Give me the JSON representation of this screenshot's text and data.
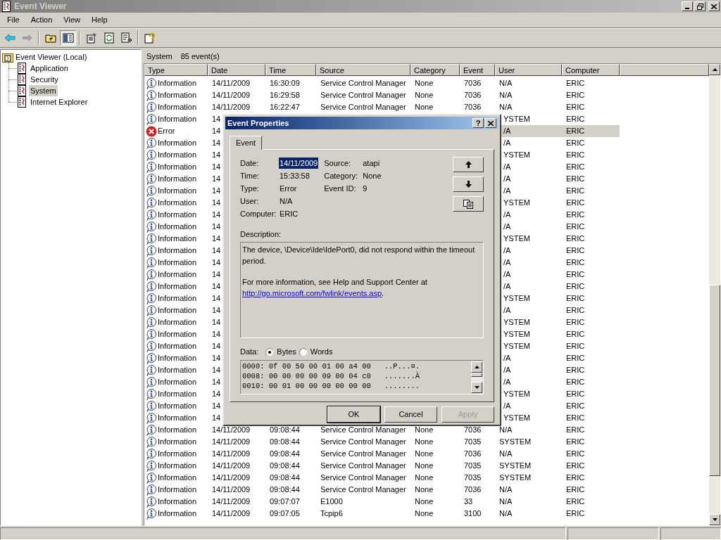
{
  "window": {
    "title": "Event Viewer"
  },
  "menu": [
    "File",
    "Action",
    "View",
    "Help"
  ],
  "toolbar": [
    {
      "kind": "back",
      "pressed": false,
      "disabled": false
    },
    {
      "kind": "forward",
      "pressed": false,
      "disabled": true
    },
    {
      "kind": "separator"
    },
    {
      "kind": "up-folder",
      "pressed": false,
      "disabled": false
    },
    {
      "kind": "tree-toggle",
      "pressed": true,
      "disabled": false
    },
    {
      "kind": "separator"
    },
    {
      "kind": "properties",
      "pressed": false,
      "disabled": false
    },
    {
      "kind": "refresh",
      "pressed": false,
      "disabled": false
    },
    {
      "kind": "export",
      "pressed": false,
      "disabled": false
    },
    {
      "kind": "separator"
    },
    {
      "kind": "help",
      "pressed": false,
      "disabled": false
    }
  ],
  "tree": {
    "label": "Event Viewer (Local)",
    "children": [
      {
        "label": "Application",
        "selected": false
      },
      {
        "label": "Security",
        "selected": false
      },
      {
        "label": "System",
        "selected": true
      },
      {
        "label": "Internet Explorer",
        "selected": false
      }
    ]
  },
  "list_header": {
    "log": "System",
    "count": "85 event(s)"
  },
  "table": {
    "columns": [
      "Type",
      "Date",
      "Time",
      "Source",
      "Category",
      "Event",
      "User",
      "Computer"
    ],
    "rows": [
      {
        "kind": "information",
        "type": "Information",
        "date": "14/11/2009",
        "time": "16:30:09",
        "source": "Service Control Manager",
        "category": "None",
        "event": "7036",
        "user": "N/A",
        "computer": "ERIC",
        "selected": false
      },
      {
        "kind": "information",
        "type": "Information",
        "date": "14/11/2009",
        "time": "16:29:58",
        "source": "Service Control Manager",
        "category": "None",
        "event": "7036",
        "user": "N/A",
        "computer": "ERIC",
        "selected": false
      },
      {
        "kind": "information",
        "type": "Information",
        "date": "14/11/2009",
        "time": "16:22:47",
        "source": "Service Control Manager",
        "category": "None",
        "event": "7036",
        "user": "N/A",
        "computer": "ERIC",
        "selected": false
      },
      {
        "kind": "information",
        "type": "Information",
        "date": "14",
        "user": "YSTEM",
        "computer": "ERIC",
        "selected": false
      },
      {
        "kind": "error",
        "type": "Error",
        "date": "14",
        "user": "/A",
        "computer": "ERIC",
        "selected": true
      },
      {
        "kind": "information",
        "type": "Information",
        "date": "14",
        "user": "/A",
        "computer": "ERIC",
        "selected": false
      },
      {
        "kind": "information",
        "type": "Information",
        "date": "14",
        "user": "YSTEM",
        "computer": "ERIC",
        "selected": false
      },
      {
        "kind": "information",
        "type": "Information",
        "date": "14",
        "user": "/A",
        "computer": "ERIC",
        "selected": false
      },
      {
        "kind": "information",
        "type": "Information",
        "date": "14",
        "user": "/A",
        "computer": "ERIC",
        "selected": false
      },
      {
        "kind": "information",
        "type": "Information",
        "date": "14",
        "user": "/A",
        "computer": "ERIC",
        "selected": false
      },
      {
        "kind": "information",
        "type": "Information",
        "date": "14",
        "user": "YSTEM",
        "computer": "ERIC",
        "selected": false
      },
      {
        "kind": "information",
        "type": "Information",
        "date": "14",
        "user": "/A",
        "computer": "ERIC",
        "selected": false
      },
      {
        "kind": "information",
        "type": "Information",
        "date": "14",
        "user": "/A",
        "computer": "ERIC",
        "selected": false
      },
      {
        "kind": "information",
        "type": "Information",
        "date": "14",
        "user": "YSTEM",
        "computer": "ERIC",
        "selected": false
      },
      {
        "kind": "information",
        "type": "Information",
        "date": "14",
        "user": "/A",
        "computer": "ERIC",
        "selected": false
      },
      {
        "kind": "information",
        "type": "Information",
        "date": "14",
        "user": "/A",
        "computer": "ERIC",
        "selected": false
      },
      {
        "kind": "information",
        "type": "Information",
        "date": "14",
        "user": "/A",
        "computer": "ERIC",
        "selected": false
      },
      {
        "kind": "information",
        "type": "Information",
        "date": "14",
        "user": "/A",
        "computer": "ERIC",
        "selected": false
      },
      {
        "kind": "information",
        "type": "Information",
        "date": "14",
        "user": "YSTEM",
        "computer": "ERIC",
        "selected": false
      },
      {
        "kind": "information",
        "type": "Information",
        "date": "14",
        "user": "/A",
        "computer": "ERIC",
        "selected": false
      },
      {
        "kind": "information",
        "type": "Information",
        "date": "14",
        "user": "YSTEM",
        "computer": "ERIC",
        "selected": false
      },
      {
        "kind": "information",
        "type": "Information",
        "date": "14",
        "user": "YSTEM",
        "computer": "ERIC",
        "selected": false
      },
      {
        "kind": "information",
        "type": "Information",
        "date": "14",
        "user": "YSTEM",
        "computer": "ERIC",
        "selected": false
      },
      {
        "kind": "information",
        "type": "Information",
        "date": "14",
        "user": "/A",
        "computer": "ERIC",
        "selected": false
      },
      {
        "kind": "information",
        "type": "Information",
        "date": "14",
        "user": "/A",
        "computer": "ERIC",
        "selected": false
      },
      {
        "kind": "information",
        "type": "Information",
        "date": "14",
        "user": "/A",
        "computer": "ERIC",
        "selected": false
      },
      {
        "kind": "information",
        "type": "Information",
        "date": "14",
        "user": "YSTEM",
        "computer": "ERIC",
        "selected": false
      },
      {
        "kind": "information",
        "type": "Information",
        "date": "14",
        "user": "/A",
        "computer": "ERIC",
        "selected": false
      },
      {
        "kind": "information",
        "type": "Information",
        "date": "14",
        "user": "YSTEM",
        "computer": "ERIC",
        "selected": false
      },
      {
        "kind": "information",
        "type": "Information",
        "date": "14/11/2009",
        "time": "09:08:44",
        "source": "Service Control Manager",
        "category": "None",
        "event": "7036",
        "user": "N/A",
        "computer": "ERIC",
        "selected": false
      },
      {
        "kind": "information",
        "type": "Information",
        "date": "14/11/2009",
        "time": "09:08:44",
        "source": "Service Control Manager",
        "category": "None",
        "event": "7035",
        "user": "SYSTEM",
        "computer": "ERIC",
        "selected": false
      },
      {
        "kind": "information",
        "type": "Information",
        "date": "14/11/2009",
        "time": "09:08:44",
        "source": "Service Control Manager",
        "category": "None",
        "event": "7036",
        "user": "N/A",
        "computer": "ERIC",
        "selected": false
      },
      {
        "kind": "information",
        "type": "Information",
        "date": "14/11/2009",
        "time": "09:08:44",
        "source": "Service Control Manager",
        "category": "None",
        "event": "7035",
        "user": "SYSTEM",
        "computer": "ERIC",
        "selected": false
      },
      {
        "kind": "information",
        "type": "Information",
        "date": "14/11/2009",
        "time": "09:08:44",
        "source": "Service Control Manager",
        "category": "None",
        "event": "7035",
        "user": "SYSTEM",
        "computer": "ERIC",
        "selected": false
      },
      {
        "kind": "information",
        "type": "Information",
        "date": "14/11/2009",
        "time": "09:08:44",
        "source": "Service Control Manager",
        "category": "None",
        "event": "7036",
        "user": "N/A",
        "computer": "ERIC",
        "selected": false
      },
      {
        "kind": "information",
        "type": "Information",
        "date": "14/11/2009",
        "time": "09:07:07",
        "source": "E1000",
        "category": "None",
        "event": "33",
        "user": "N/A",
        "computer": "ERIC",
        "selected": false
      },
      {
        "kind": "information",
        "type": "Information",
        "date": "14/11/2009",
        "time": "09:07:05",
        "source": "Tcpip6",
        "category": "None",
        "event": "3100",
        "user": "N/A",
        "computer": "ERIC",
        "selected": false
      }
    ]
  },
  "dialog": {
    "title": "Event Properties",
    "help_button": "?",
    "tabs": [
      {
        "label": "Event",
        "selected": true
      }
    ],
    "fields_left": [
      {
        "label": "Date:",
        "value": "14/11/2009",
        "selected": true
      },
      {
        "label": "Time:",
        "value": "15:33:58",
        "selected": false
      },
      {
        "label": "Type:",
        "value": "Error",
        "selected": false
      },
      {
        "label": "User:",
        "value": "N/A",
        "selected": false
      },
      {
        "label": "Computer:",
        "value": "ERIC",
        "selected": false
      }
    ],
    "fields_right": [
      {
        "label": "Source:",
        "value": "atapi",
        "selected": false
      },
      {
        "label": "Category:",
        "value": "None",
        "selected": false
      },
      {
        "label": "Event ID:",
        "value": "9",
        "selected": false
      }
    ],
    "nav_buttons": [
      {
        "kind": "up"
      },
      {
        "kind": "down"
      },
      {
        "kind": "copy"
      }
    ],
    "description_label": "Description:",
    "description": {
      "text": "The device, \\Device\\Ide\\IdePort0, did not respond within the timeout period.",
      "more": "For more information, see Help and Support Center at",
      "link": "http://go.microsoft.com/fwlink/events.asp",
      "after": "."
    },
    "data_label": "Data:",
    "data_formats": [
      {
        "label": "Bytes",
        "selected": true
      },
      {
        "label": "Words",
        "selected": false
      }
    ],
    "data_lines": [
      "0000: 0f 00 50 00 01 00 a4 00   ..P...¤.",
      "0008: 00 00 00 00 09 00 04 c0   .......À",
      "0010: 00 01 00 00 00 00 00 00   ........"
    ],
    "buttons": [
      {
        "label": "OK",
        "default": true,
        "disabled": false
      },
      {
        "label": "Cancel",
        "default": false,
        "disabled": false
      },
      {
        "label": "Apply",
        "default": false,
        "disabled": true
      }
    ]
  }
}
